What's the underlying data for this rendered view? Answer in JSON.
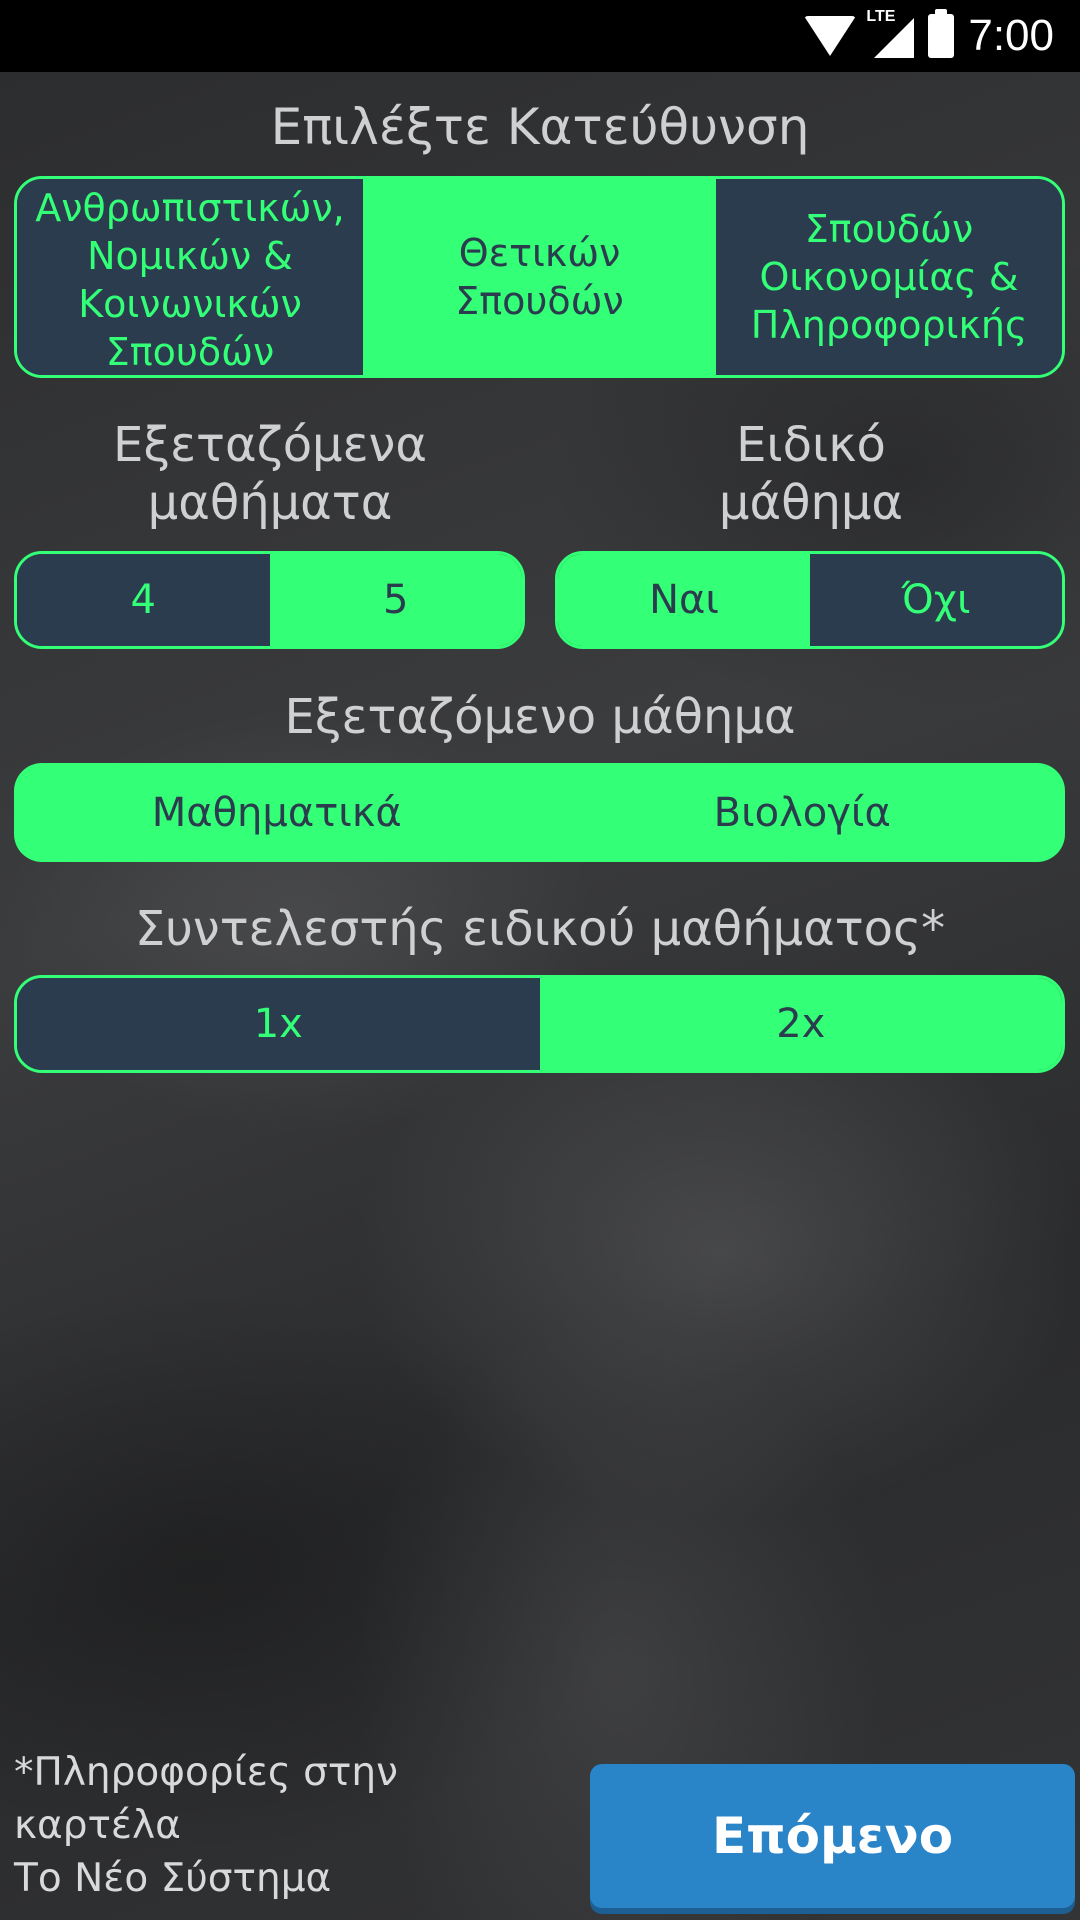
{
  "status_bar": {
    "time": "7:00",
    "network": "LTE",
    "icons": [
      "wifi-icon",
      "lte-signal-icon",
      "battery-icon"
    ]
  },
  "direction": {
    "title": "Επιλέξτε Κατεύθυνση",
    "options": [
      "Ανθρωπιστικών,\nΝομικών &\nΚοινωνικών\nΣπουδών",
      "Θετικών\nΣπουδών",
      "Σπουδών\nΟικονομίας &\nΠληροφορικής"
    ],
    "selected": "Θετικών Σπουδών"
  },
  "exam_subjects": {
    "title": "Εξεταζόμενα\nμαθήματα",
    "options": [
      "4",
      "5"
    ],
    "selected": "5"
  },
  "special_subject": {
    "title": "Ειδικό\nμάθημα",
    "options": [
      "Ναι",
      "Όχι"
    ],
    "selected": "Ναι"
  },
  "examined_subject": {
    "title": "Εξεταζόμενο μάθημα",
    "options": [
      "Μαθηματικά",
      "Βιολογία"
    ]
  },
  "coefficient": {
    "title": "Συντελεστής ειδικού μαθήματος*",
    "options": [
      "1x",
      "2x"
    ],
    "selected": "2x"
  },
  "footnote": "*Πληροφορίες στην\nκαρτέλα\n Το Νέο Σύστημα",
  "next_button": "Επόμενο",
  "colors": {
    "accent_green": "#33ff77",
    "dark_navy": "#2b3c4e",
    "button_blue": "#2a84c8"
  }
}
